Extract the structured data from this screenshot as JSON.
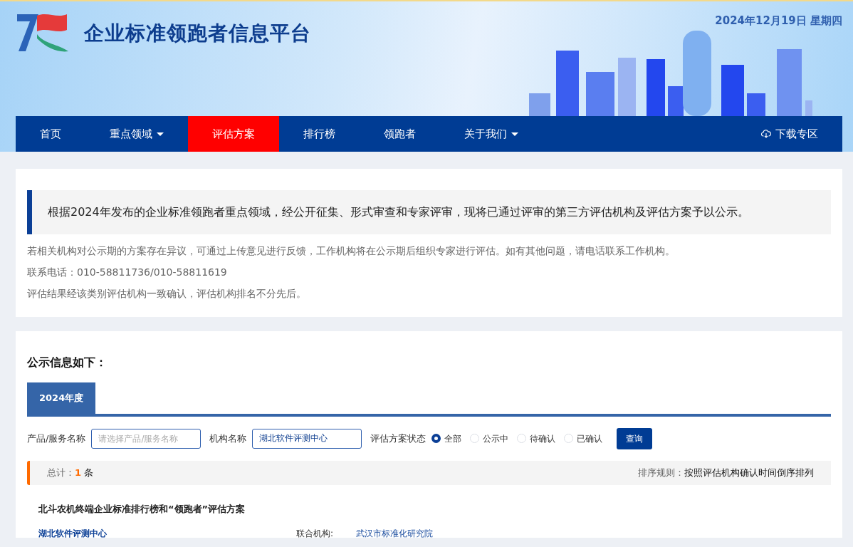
{
  "header": {
    "title": "企业标准领跑者信息平台",
    "date": "2024年12月19日 星期四"
  },
  "nav": {
    "items": [
      {
        "label": "首页",
        "selected": false,
        "dropdown": false
      },
      {
        "label": "重点领域",
        "selected": false,
        "dropdown": true
      },
      {
        "label": "评估方案",
        "selected": true,
        "dropdown": false
      },
      {
        "label": "排行榜",
        "selected": false,
        "dropdown": false
      },
      {
        "label": "领跑者",
        "selected": false,
        "dropdown": false
      },
      {
        "label": "关于我们",
        "selected": false,
        "dropdown": true
      }
    ],
    "download": "下载专区"
  },
  "notice": {
    "highlight": "根据2024年发布的企业标准领跑者重点领域，经公开征集、形式审查和专家评审，现将已通过评审的第三方评估机构及评估方案予以公示。",
    "lines": [
      "若相关机构对公示期的方案存在异议，可通过上传意见进行反馈，工作机构将在公示期后组织专家进行评估。如有其他问题，请电话联系工作机构。",
      "联系电话：010-58811736/010-58811619",
      "评估结果经该类别评估机构一致确认，评估机构排名不分先后。"
    ]
  },
  "listing": {
    "heading": "公示信息如下：",
    "tabs": [
      {
        "label": "2024年度",
        "selected": true
      }
    ],
    "filters": {
      "product_label": "产品/服务名称",
      "product_placeholder": "请选择产品/服务名称",
      "org_label": "机构名称",
      "org_value": "湖北软件评测中心",
      "status_label": "评估方案状态",
      "status_options": [
        {
          "label": "全部",
          "selected": true
        },
        {
          "label": "公示中",
          "selected": false
        },
        {
          "label": "待确认",
          "selected": false
        },
        {
          "label": "已确认",
          "selected": false
        }
      ],
      "query_button": "查询"
    },
    "summary": {
      "total_label": "总计：",
      "total_count": "1",
      "total_unit": "条",
      "sort_label": "排序规则：",
      "sort_value": "按照评估机构确认时间倒序排列"
    },
    "results": [
      {
        "title": "北斗农机终端企业标准排行榜和“领跑者”评估方案",
        "org": "湖北软件评测中心",
        "partner_label": "联合机构:",
        "partner": "武汉市标准化研究院"
      }
    ]
  }
}
